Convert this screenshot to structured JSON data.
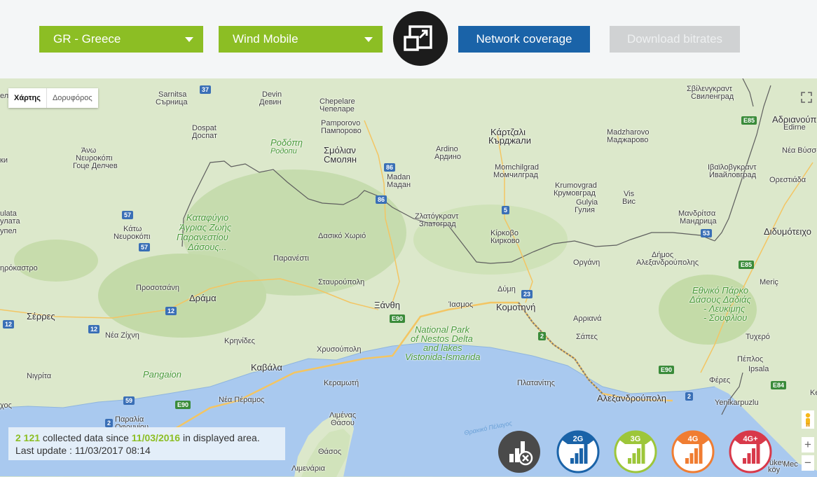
{
  "toolbar": {
    "country_select": "GR - Greece",
    "operator_select": "Wind Mobile",
    "coverage_button": "Network coverage",
    "download_button": "Download bitrates"
  },
  "map": {
    "type_map": "Χάρτης",
    "type_satellite": "Δορυφόρος",
    "zoom_in": "+",
    "zoom_out": "−",
    "labels": {
      "sarnitsa": "Sarnitsa",
      "sarnitsa_cy": "Сърница",
      "devin": "Devin",
      "devin_cy": "Девин",
      "chepelare": "Chepelare",
      "chepelare_cy": "Чепеларе",
      "pamporovo": "Pamporovo",
      "pamporovo_cy": "Пампорово",
      "kardzhali": "Κάρτζαλι",
      "kardzhali_cy": "Кърджали",
      "madzharovo": "Madzharovo",
      "madzharovo_cy": "Маджарово",
      "svilengrad": "Σβίλενγκραντ",
      "svilengrad_cy": "Свиленград",
      "adrianople": "Αδριανούπ",
      "edirne": "Edirne",
      "dospat": "Dospat",
      "dospat_cy": "Доспат",
      "rodopi": "Ροδόπη",
      "rodopi_cy": "Родопи",
      "smolyan": "Σμόλιαν",
      "smolyan_cy": "Смолян",
      "ardino": "Ardino",
      "ardino_cy": "Ардино",
      "ano_nevrokopi": "Άνω",
      "ano_nevrokopi2": "Νευροκόπι",
      "gotse": "Гоце Делчев",
      "madan": "Madan",
      "madan_cy": "Мадан",
      "momchilgrad": "Momchilgrad",
      "momchilgrad_cy": "Момчилград",
      "ivaylovgrad": "Ιβαϊλοβγκραντ",
      "ivaylovgrad_cy": "Ивайловград",
      "nea_vyssa": "Νέα Βύσσα",
      "krumovgrad": "Krumovgrad",
      "krumovgrad_cy": "Крумовград",
      "gulyia": "Gulyia",
      "gulyia_cy": "Гулия",
      "vis": "Vis",
      "vis_cy": "Вис",
      "orestiada": "Ορεστιάδα",
      "zlatograd": "Ζλατόγκραντ",
      "zlatograd_cy": "Златоград",
      "katafygio1": "Καταφύγιο",
      "katafygio2": "Άγριας Ζωής",
      "katafygio3": "Παρανεστίου",
      "katafygio4": "Δάσους...",
      "kato_nevrokopi": "Κάτω",
      "kato_nevrokopi2": "Νευροκόπι",
      "dasiko": "Δασικό Χωριό",
      "kirkovo": "Κίρκοβο",
      "kirkovo_cy": "Кирково",
      "mandritsa": "Μανδρίτσα",
      "mandritsa_cy": "Мандрица",
      "didymoteicho": "Διδυμότειχο",
      "ulata": "ulata",
      "ulata_cy": "улата",
      "upel": "упел",
      "orgkani": "Οργάνη",
      "dimos": "Δήμος",
      "dimos2": "Αλεξανδρούπολης",
      "sidirokastro": "ηρόκαστρο",
      "paranesti": "Παρανέστι",
      "stavroupoli": "Σταυρούπολη",
      "meric": "Meriç",
      "prosotsani": "Προσοτσάνη",
      "drama": "Δράμα",
      "dymi": "Δύμη",
      "xanthi": "Ξάνθη",
      "iasmos": "Ίασμος",
      "komotini": "Κομοτηνή",
      "evros1": "Εθνικό Πάρκο",
      "evros2": "Δάσους Δαδιάς",
      "evros3": "- Λευκίμης",
      "evros4": "- Σουφλίου",
      "serres": "Σέρρες",
      "nea_zichni": "Νέα Ζίχνη",
      "krinides": "Κρηνίδες",
      "arriana": "Αρριανά",
      "sapes": "Σάπες",
      "tychero": "Τυχερό",
      "nestos1": "National Park",
      "nestos2": "of Nestos Delta",
      "nestos3": "and lakes",
      "nestos4": "Vistonida-Ismarida",
      "chrysoupoli": "Χρυσούπολη",
      "peplos": "Πέπλος",
      "pangaion": "Pangaion",
      "kavala": "Καβάλα",
      "nigrita": "Νιγρίτα",
      "keramoti": "Κεραμωτή",
      "ferres": "Φέρες",
      "ipsala": "Ipsala",
      "platanitis": "Πλατανίτης",
      "alexandroupoli": "Αλεξανδρούπολη",
      "yenikarpuzlu": "Yenikarpuzlu",
      "nea_peramos": "Νέα Πέραμος",
      "limenas": "Λιμένας",
      "thasou": "Θάσου",
      "paralia": "Παραλία",
      "ofrynio": "Οφρυνίου",
      "sxos": "χος",
      "thracian_sea": "Θρακικό Πέλαγος",
      "thasos": "Θάσος",
      "limenaria": "Λιμενάρια",
      "ke": "Ke",
      "ukev": "ükev",
      "mec": "Mec",
      "koy": "köy",
      "el": "ел",
      "ki": "ки"
    },
    "roads": [
      "37",
      "86",
      "86",
      "5",
      "53",
      "57",
      "57",
      "E85",
      "E85",
      "23",
      "E90",
      "12",
      "12",
      "12",
      "2",
      "E90",
      "59",
      "E90",
      "2",
      "E84",
      "2"
    ]
  },
  "info": {
    "count": "2 121",
    "text_collected": " collected data since ",
    "since_date": "11/03/2016",
    "text_area": " in displayed area.",
    "last_update": "Last update : 11/03/2017 08:14"
  },
  "tech_buttons": [
    {
      "label": "",
      "color": "#4a4a4a"
    },
    {
      "label": "2G",
      "color": "#1a63a8"
    },
    {
      "label": "3G",
      "color": "#9dc63a"
    },
    {
      "label": "4G",
      "color": "#f07d32"
    },
    {
      "label": "4G+",
      "color": "#d8394a"
    }
  ]
}
